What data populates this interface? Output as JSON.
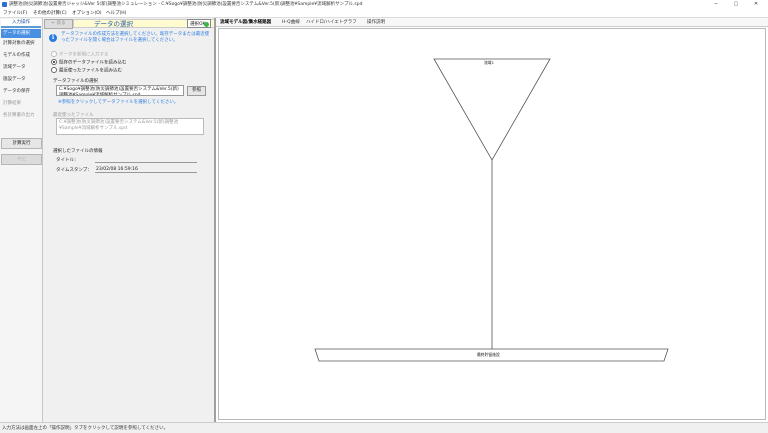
{
  "window": {
    "title": "調整池(防災調節池)設置要否ジャッジ&Ver 5(新)調整池シミュレーション - C:¥Sogo¥調整池(防災調節池)設置要否システム&Ver.5(新)調整池¥Sample¥流域解析サンプル.spd",
    "minimize": "─",
    "maximize": "▢",
    "close": "✕"
  },
  "menu": {
    "items": [
      "ファイル(F)",
      "その他の計算(C)",
      "オプション(O)",
      "ヘルプ(H)"
    ]
  },
  "leftnav": {
    "header": "入力操作",
    "items": [
      {
        "label": "データの選択",
        "state": "active"
      },
      {
        "label": "計算対象の選択",
        "state": "normal"
      },
      {
        "label": "モデルの作成",
        "state": "normal"
      },
      {
        "label": "流域データ",
        "state": "normal"
      },
      {
        "label": "施設データ",
        "state": "normal"
      },
      {
        "label": "データの保存",
        "state": "normal"
      },
      {
        "label": "計算結果",
        "state": "dim"
      },
      {
        "label": "各計算書の出力",
        "state": "dim"
      }
    ],
    "calc_button": "計算実行",
    "disabled_button": "中止"
  },
  "midpanel": {
    "back_button": "← 戻る",
    "title": "データの選択",
    "ok_button": "選択OK",
    "info_text": "データファイルの作成方法を選択してください。既存データまたは最近使ったファイルを開く場合はファイルを選択してください。",
    "radios": [
      {
        "label": "データを新規に入力する",
        "checked": false,
        "disabled": true
      },
      {
        "label": "既存のデータファイルを読み込む",
        "checked": true,
        "disabled": false
      },
      {
        "label": "最近使ったファイルを読み込む",
        "checked": false,
        "disabled": false
      }
    ],
    "file_section_label": "データファイルの選択",
    "file_path": "C:¥Sogo¥調整池(防災調節池)設置要否システム&Ver.5(新)調整池¥Sample¥流域解析サンプル.spd",
    "ref_button": "参照",
    "hint": "※参照をクリックしてデータファイルを選択してください。",
    "recent_label": "最近使ったファイル",
    "recent_path": "C:¥調整池(防災調節池)設置要否システム&Ver.5(新)調整池¥Sample¥流域解析サンプル.spd",
    "selected_section_label": "選択したファイルの情報",
    "title_label": "タイトル：",
    "title_value": "",
    "timestamp_label": "タイムスタンプ：",
    "timestamp_value": "23/02/08 16:59:16"
  },
  "rightpanel": {
    "tabs": [
      {
        "label": "流域モデル図/集水経路図",
        "active": true
      },
      {
        "label": "H-Q曲線",
        "active": false
      },
      {
        "label": "ハイドロ/ハイエトグラフ",
        "active": false
      },
      {
        "label": "操作説明",
        "active": false
      }
    ],
    "diagram": {
      "top_node": "流域1",
      "bottom_node": "最終貯留施設"
    }
  },
  "statusbar": {
    "text": "入力方法は画面左上の「操作説明」タブをクリックして説明を参照してください。"
  }
}
